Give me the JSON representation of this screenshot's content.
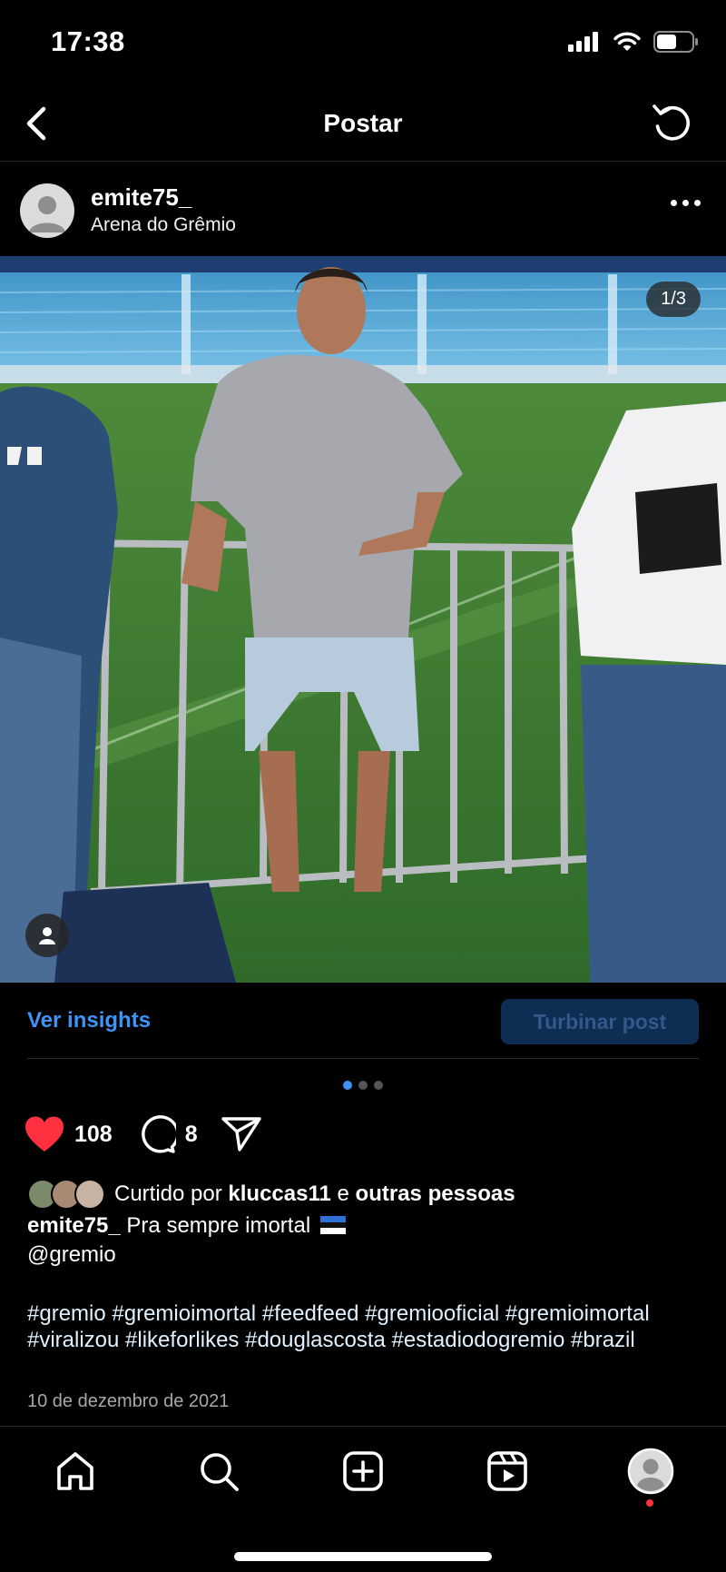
{
  "status_bar": {
    "time": "17:38",
    "icons": [
      "signal-icon",
      "wifi-icon",
      "battery-icon"
    ]
  },
  "nav": {
    "title": "Postar",
    "back_icon": "chevron-left-icon",
    "refresh_icon": "refresh-icon"
  },
  "post": {
    "username": "emite75_",
    "location": "Arena do Grêmio",
    "image_counter": "1/3",
    "carousel": {
      "current": 1,
      "total": 3
    },
    "insights_label": "Ver insights",
    "boost_label": "Turbinar post",
    "likes": "108",
    "comments": "8",
    "liked_by_prefix": "Curtido por",
    "liked_by_user": "kluccas11",
    "liked_by_joiner": "e",
    "liked_by_others": "outras pessoas",
    "caption_user": "emite75_",
    "caption_text": "Pra sempre imortal",
    "caption_mention": "@gremio",
    "hashtags": "#gremio #gremioimortal #feedfeed #gremiooficial #gremioimortal #viralizou #likeforlikes #douglascosta #estadiodogremio #brazil",
    "date": "10 de dezembro de 2021"
  },
  "colors": {
    "accent": "#3f93f5",
    "like": "#ff3040",
    "background": "#000000",
    "boost_bg": "#0e2d52"
  },
  "tabbar": {
    "items": [
      "home-icon",
      "search-icon",
      "create-icon",
      "reels-icon",
      "profile-icon"
    ]
  }
}
